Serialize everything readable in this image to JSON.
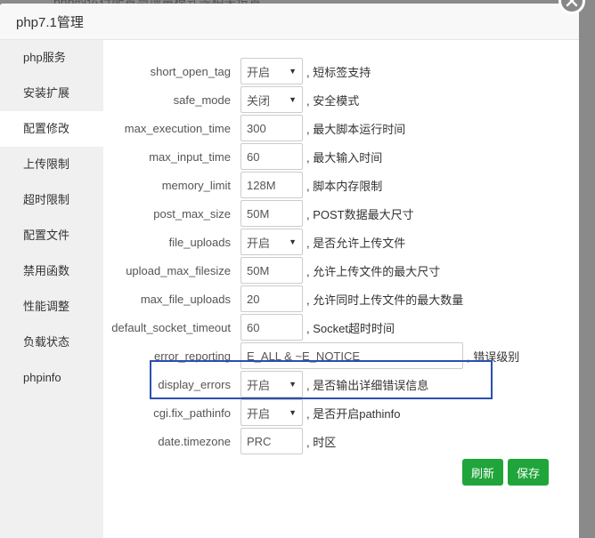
{
  "background_text": "php的运行配置与增量模式等相关设置",
  "dialog": {
    "title": "php7.1管理"
  },
  "sidebar": {
    "items": [
      {
        "label": "php服务"
      },
      {
        "label": "安装扩展"
      },
      {
        "label": "配置修改"
      },
      {
        "label": "上传限制"
      },
      {
        "label": "超时限制"
      },
      {
        "label": "配置文件"
      },
      {
        "label": "禁用函数"
      },
      {
        "label": "性能调整"
      },
      {
        "label": "负载状态"
      },
      {
        "label": "phpinfo"
      }
    ],
    "active": "配置修改"
  },
  "config": {
    "rows": [
      {
        "name": "short_open_tag",
        "value": "开启",
        "type": "select",
        "desc": ", 短标签支持"
      },
      {
        "name": "safe_mode",
        "value": "关闭",
        "type": "select",
        "desc": ", 安全模式"
      },
      {
        "name": "max_execution_time",
        "value": "300",
        "type": "input",
        "desc": ", 最大脚本运行时间"
      },
      {
        "name": "max_input_time",
        "value": "60",
        "type": "input",
        "desc": ", 最大输入时间"
      },
      {
        "name": "memory_limit",
        "value": "128M",
        "type": "input",
        "desc": ", 脚本内存限制"
      },
      {
        "name": "post_max_size",
        "value": "50M",
        "type": "input",
        "desc": ", POST数据最大尺寸"
      },
      {
        "name": "file_uploads",
        "value": "开启",
        "type": "select",
        "desc": ", 是否允许上传文件"
      },
      {
        "name": "upload_max_filesize",
        "value": "50M",
        "type": "input",
        "desc": ", 允许上传文件的最大尺寸"
      },
      {
        "name": "max_file_uploads",
        "value": "20",
        "type": "input",
        "desc": ", 允许同时上传文件的最大数量"
      },
      {
        "name": "default_socket_timeout",
        "value": "60",
        "type": "input",
        "desc": ", Socket超时时间"
      },
      {
        "name": "error_reporting",
        "value": "E_ALL & ~E_NOTICE",
        "type": "wide",
        "desc": ", 错误级别"
      },
      {
        "name": "display_errors",
        "value": "开启",
        "type": "select",
        "desc": ", 是否输出详细错误信息"
      },
      {
        "name": "cgi.fix_pathinfo",
        "value": "开启",
        "type": "select",
        "desc": ", 是否开启pathinfo"
      },
      {
        "name": "date.timezone",
        "value": "PRC",
        "type": "input",
        "desc": ", 时区"
      }
    ]
  },
  "buttons": {
    "refresh": "刷新",
    "save": "保存"
  },
  "colors": {
    "accent": "#20a53a",
    "highlight": "#2b4fb0"
  }
}
